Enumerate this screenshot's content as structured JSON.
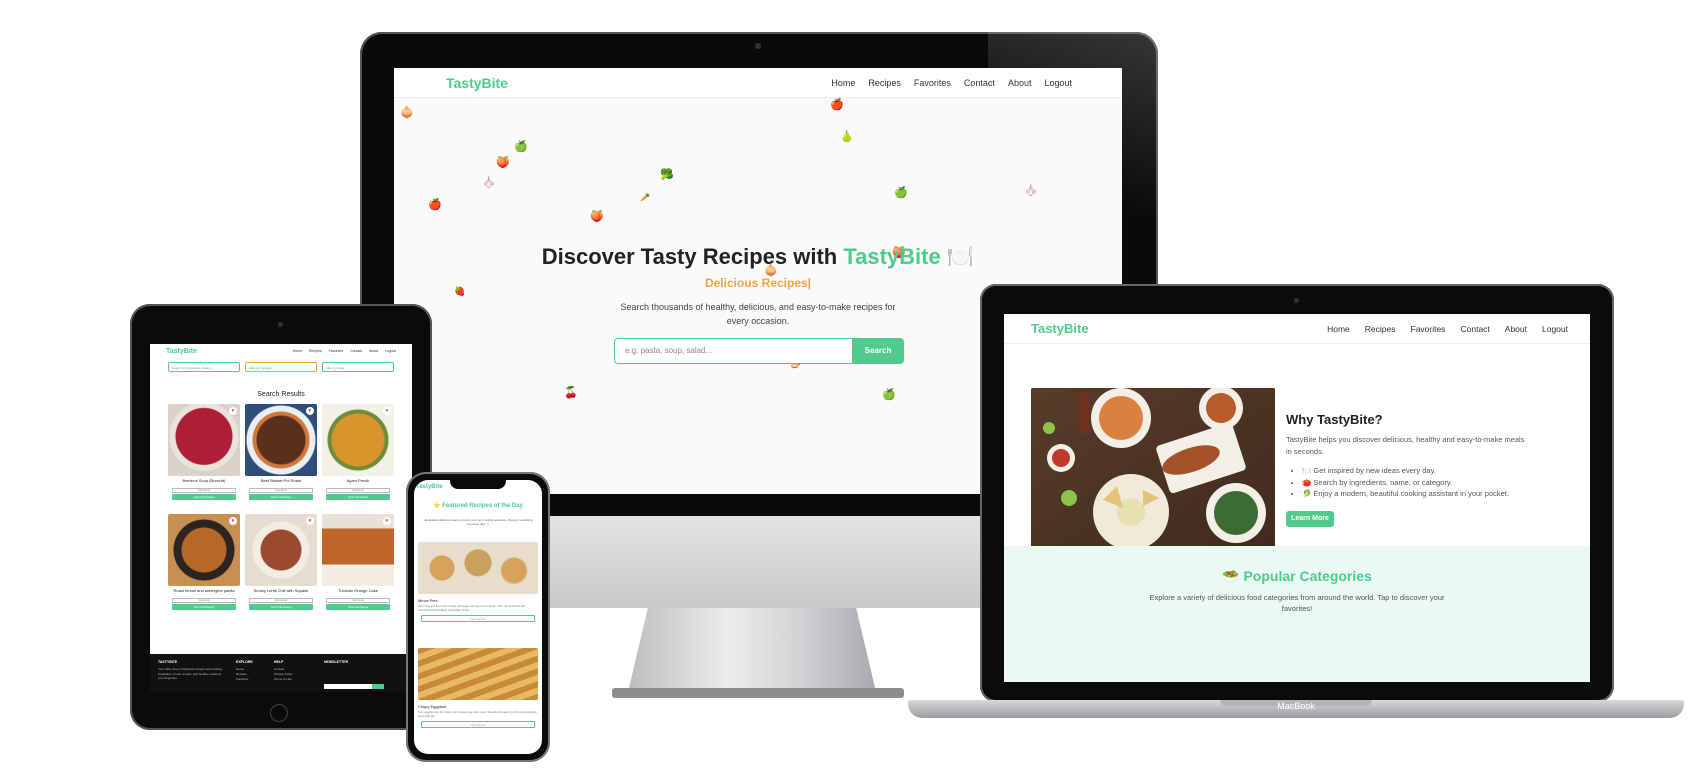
{
  "brand": "TastyBite",
  "nav": [
    "Home",
    "Recipes",
    "Favorites",
    "Contact",
    "About",
    "Logout"
  ],
  "imac": {
    "hero_title_prefix": "Discover Tasty Recipes with ",
    "hero_title_accent": "TastyBite",
    "hero_icon": "🍽️",
    "hero_subtitle": "Delicious Recipes|",
    "hero_desc": "Search thousands of healthy, delicious, and easy-to-make recipes for every occasion.",
    "search_placeholder": "e.g. pasta, soup, salad...",
    "search_button": "Search"
  },
  "macbook": {
    "why_title": "Why TastyBite?",
    "why_text": "TastyBite helps you discover delicious, healthy and easy-to-make meals in seconds.",
    "why_points": [
      "🍽️ Get inspired by new ideas every day.",
      "🍅 Search by ingredients, name, or category.",
      "🥬 Enjoy a modern, beautiful cooking assistant in your pocket."
    ],
    "learn_more": "Learn More",
    "categories_icon": "🥗",
    "categories_title": "Popular Categories",
    "categories_desc": "Explore a variety of delicious food categories from around the world. Tap to discover your favorites!",
    "device_label": "MacBook"
  },
  "ipad": {
    "search_placeholder": "Search by recipe title, dietary, ...",
    "filter_category": "Filter by Category",
    "filter_area": "Filter by Area",
    "results_title": "Search Results",
    "recipes": [
      {
        "name": "Beetroot Soup (Borscht)",
        "color": "#8b1e2d"
      },
      {
        "name": "Beef Brisket Pot Roast",
        "color": "#6b3a22"
      },
      {
        "name": "Ayam Percik",
        "color": "#c98a2a"
      },
      {
        "name": "Roast fennel and aubergine paella",
        "color": "#b5682a"
      },
      {
        "name": "Smoky Lentil Chili with Squash",
        "color": "#9c4a2e"
      },
      {
        "name": "Tunisian Orange Cake",
        "color": "#c0652b"
      }
    ],
    "ingredients_label": "Ingredients",
    "view_button": "View Full Recipe",
    "footer": {
      "brand": "TASTYBITE",
      "tagline": "Your daily dose of delicious recipes and cooking inspiration. Fresh, simple, and healthy meals at your fingertips.",
      "explore": "EXPLORE",
      "explore_links": [
        "Home",
        "Recipes",
        "Favorites"
      ],
      "help": "HELP",
      "help_links": [
        "Contact",
        "Privacy Policy",
        "Terms of Use"
      ],
      "newsletter": "NEWSLETTER"
    }
  },
  "iphone": {
    "featured_title": "⭐ Featured Recipes of the Day",
    "featured_desc": "Handpicked delicious meals to inspire your next cooking adventure. Discover something new every day! 🍴",
    "recipes": [
      {
        "name": "Mince Pies",
        "text": "Rub butter into flour until crumbly, add sugar and egg to form dough. Chill, roll out and fill with mincemeat before baking until golden brown.",
        "color": "#c49a5a"
      },
      {
        "name": "Crispy Eggplant",
        "text": "Slice eggplant into thin strips, dip in beaten egg, then coat in breadcrumbs and fry until crisp and golden. Serve with dip.",
        "color": "#d6a552"
      }
    ],
    "view_button": "View Recipe"
  },
  "colors": {
    "accent": "#4ecb8d",
    "orange": "#f0a340",
    "light_green": "#eafaf2"
  }
}
